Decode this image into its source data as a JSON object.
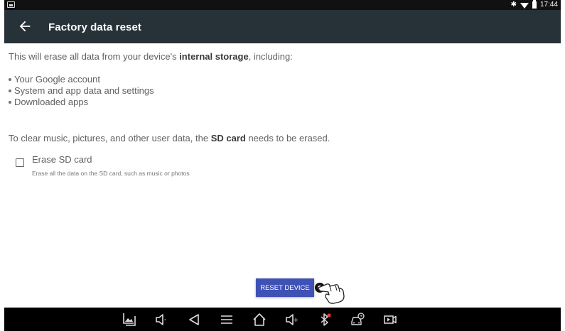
{
  "status_bar": {
    "time": "17:44",
    "icons": [
      "notification-image-icon",
      "bluetooth-icon",
      "wifi-icon",
      "battery-icon"
    ],
    "bluetooth_glyph": "✱"
  },
  "toolbar": {
    "title": "Factory data reset",
    "back_icon": "arrow-left-icon"
  },
  "content": {
    "intro_prefix": "This will erase all data from your device's ",
    "intro_bold": "internal storage",
    "intro_suffix": ", including:",
    "bullets": [
      "Your Google account",
      "System and app data and settings",
      "Downloaded apps"
    ],
    "sd_prefix": "To clear music, pictures, and other user data, the ",
    "sd_bold": "SD card",
    "sd_suffix": " needs to be erased."
  },
  "erase_sd": {
    "checked": false,
    "title": "Erase SD card",
    "subtitle": "Erase all the data on the SD card, such as music or photos"
  },
  "reset_button": {
    "label": "RESET DEVICE"
  },
  "nav_bar": {
    "items": [
      "screenshot-icon",
      "volume-down-icon",
      "back-icon",
      "menu-icon",
      "home-icon",
      "volume-up-icon",
      "bluetooth-icon",
      "car-diagnostics-icon",
      "video-record-icon"
    ],
    "volume_down_label": "-",
    "volume_up_label": "+"
  },
  "colors": {
    "toolbar": "#263238",
    "button": "#3f51b5",
    "status_bar": "#111111",
    "nav_bar": "#000000",
    "bluetooth_badge": "#e53935"
  }
}
